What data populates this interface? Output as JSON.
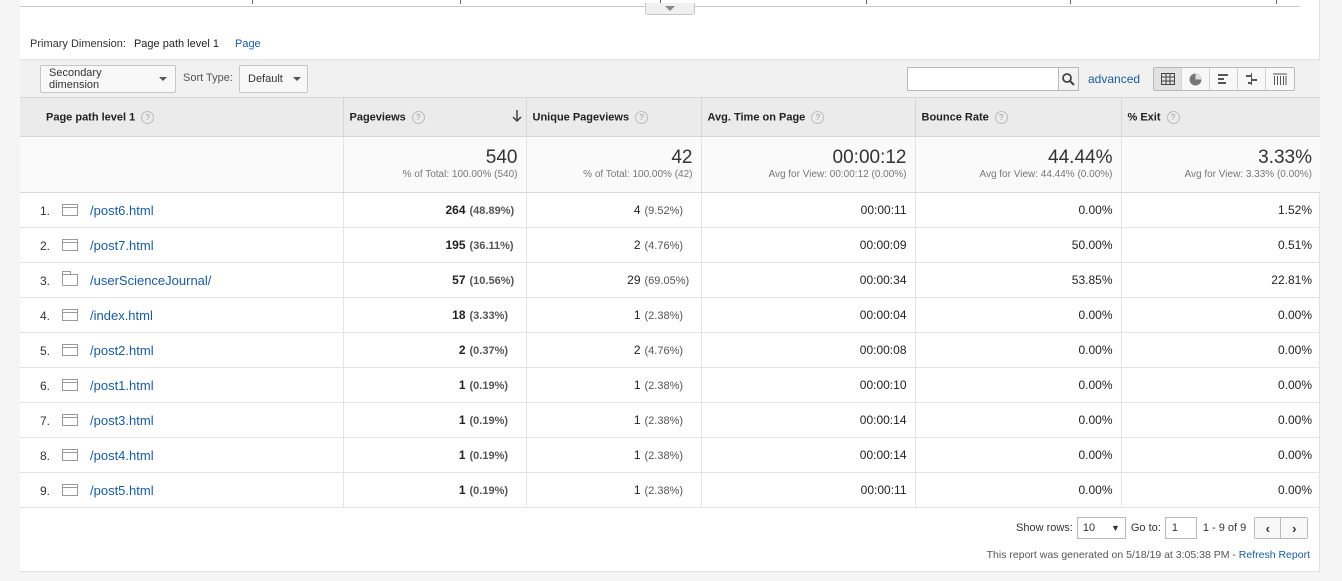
{
  "primary_dimension": {
    "label": "Primary Dimension:",
    "active": "Page path level 1",
    "alternate": "Page"
  },
  "toolbar": {
    "secondary_dimension": "Secondary dimension",
    "sort_type_label": "Sort Type:",
    "sort_type_value": "Default",
    "search_placeholder": "",
    "advanced": "advanced",
    "view_icons": [
      "table-view-icon",
      "pie-view-icon",
      "performance-view-icon",
      "comparison-view-icon",
      "pivot-view-icon"
    ]
  },
  "table": {
    "headers": [
      "Page path level 1",
      "Pageviews",
      "Unique Pageviews",
      "Avg. Time on Page",
      "Bounce Rate",
      "% Exit"
    ],
    "help_mark": "?",
    "totals": [
      {
        "value": "540",
        "sub": "% of Total: 100.00% (540)"
      },
      {
        "value": "42",
        "sub": "% of Total: 100.00% (42)"
      },
      {
        "value": "00:00:12",
        "sub": "Avg for View: 00:00:12 (0.00%)"
      },
      {
        "value": "44.44%",
        "sub": "Avg for View: 44.44% (0.00%)"
      },
      {
        "value": "3.33%",
        "sub": "Avg for View: 3.33% (0.00%)"
      }
    ],
    "rows": [
      {
        "num": "1.",
        "icon": "page-icon",
        "path": "/post6.html",
        "pv": "264",
        "pv_pct": "(48.89%)",
        "upv": "4",
        "upv_pct": "(9.52%)",
        "time": "00:00:11",
        "bounce": "0.00%",
        "exit": "1.52%"
      },
      {
        "num": "2.",
        "icon": "page-icon",
        "path": "/post7.html",
        "pv": "195",
        "pv_pct": "(36.11%)",
        "upv": "2",
        "upv_pct": "(4.76%)",
        "time": "00:00:09",
        "bounce": "50.00%",
        "exit": "0.51%"
      },
      {
        "num": "3.",
        "icon": "folder-icon",
        "path": "/userScienceJournal/",
        "pv": "57",
        "pv_pct": "(10.56%)",
        "upv": "29",
        "upv_pct": "(69.05%)",
        "time": "00:00:34",
        "bounce": "53.85%",
        "exit": "22.81%"
      },
      {
        "num": "4.",
        "icon": "page-icon",
        "path": "/index.html",
        "pv": "18",
        "pv_pct": "(3.33%)",
        "upv": "1",
        "upv_pct": "(2.38%)",
        "time": "00:00:04",
        "bounce": "0.00%",
        "exit": "0.00%"
      },
      {
        "num": "5.",
        "icon": "page-icon",
        "path": "/post2.html",
        "pv": "2",
        "pv_pct": "(0.37%)",
        "upv": "2",
        "upv_pct": "(4.76%)",
        "time": "00:00:08",
        "bounce": "0.00%",
        "exit": "0.00%"
      },
      {
        "num": "6.",
        "icon": "page-icon",
        "path": "/post1.html",
        "pv": "1",
        "pv_pct": "(0.19%)",
        "upv": "1",
        "upv_pct": "(2.38%)",
        "time": "00:00:10",
        "bounce": "0.00%",
        "exit": "0.00%"
      },
      {
        "num": "7.",
        "icon": "page-icon",
        "path": "/post3.html",
        "pv": "1",
        "pv_pct": "(0.19%)",
        "upv": "1",
        "upv_pct": "(2.38%)",
        "time": "00:00:14",
        "bounce": "0.00%",
        "exit": "0.00%"
      },
      {
        "num": "8.",
        "icon": "page-icon",
        "path": "/post4.html",
        "pv": "1",
        "pv_pct": "(0.19%)",
        "upv": "1",
        "upv_pct": "(2.38%)",
        "time": "00:00:14",
        "bounce": "0.00%",
        "exit": "0.00%"
      },
      {
        "num": "9.",
        "icon": "page-icon",
        "path": "/post5.html",
        "pv": "1",
        "pv_pct": "(0.19%)",
        "upv": "1",
        "upv_pct": "(2.38%)",
        "time": "00:00:11",
        "bounce": "0.00%",
        "exit": "0.00%"
      }
    ]
  },
  "footer": {
    "show_rows_label": "Show rows:",
    "show_rows_value": "10",
    "goto_label": "Go to:",
    "goto_value": "1",
    "range": "1 - 9 of 9",
    "prev": "‹",
    "next": "›",
    "generated": "This report was generated on 5/18/19 at 3:05:38 PM - ",
    "refresh": "Refresh Report"
  },
  "colors": {
    "link": "#1a5b9c",
    "header_bg": "#ebebeb",
    "toolbar_bg": "#f1f1f1"
  }
}
